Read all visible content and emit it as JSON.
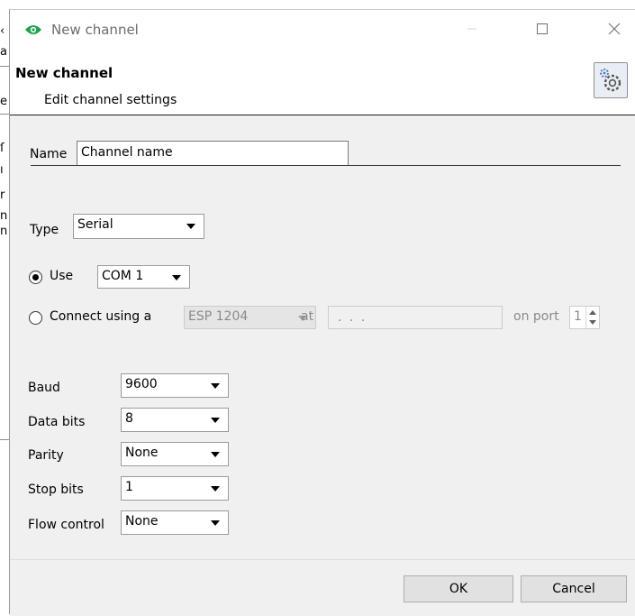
{
  "background_window": {
    "fragments": [
      "‹",
      "a",
      "e",
      "ſ",
      "ı",
      "r",
      "n",
      "n"
    ]
  },
  "titlebar": {
    "title": "New channel",
    "app_icon": "eye-icon",
    "accent": "#1ba34e"
  },
  "header": {
    "title": "New channel",
    "subtitle": "Edit channel settings",
    "icon": "settings-gear-icon"
  },
  "form": {
    "name_label": "Name",
    "name_value": "Channel name",
    "type_label": "Type",
    "type_value": "Serial",
    "use_label": "Use",
    "use_value": "COM 1",
    "connect_label": "Connect using a",
    "connect_device": "ESP 1204",
    "at_label": "at",
    "ip_value": ". . .",
    "on_port_label": "on port",
    "port_value": "1",
    "baud_label": "Baud",
    "baud_value": "9600",
    "databits_label": "Data bits",
    "databits_value": "8",
    "parity_label": "Parity",
    "parity_value": "None",
    "stopbits_label": "Stop bits",
    "stopbits_value": "1",
    "flow_label": "Flow control",
    "flow_value": "None"
  },
  "footer": {
    "ok_label": "OK",
    "cancel_label": "Cancel"
  }
}
